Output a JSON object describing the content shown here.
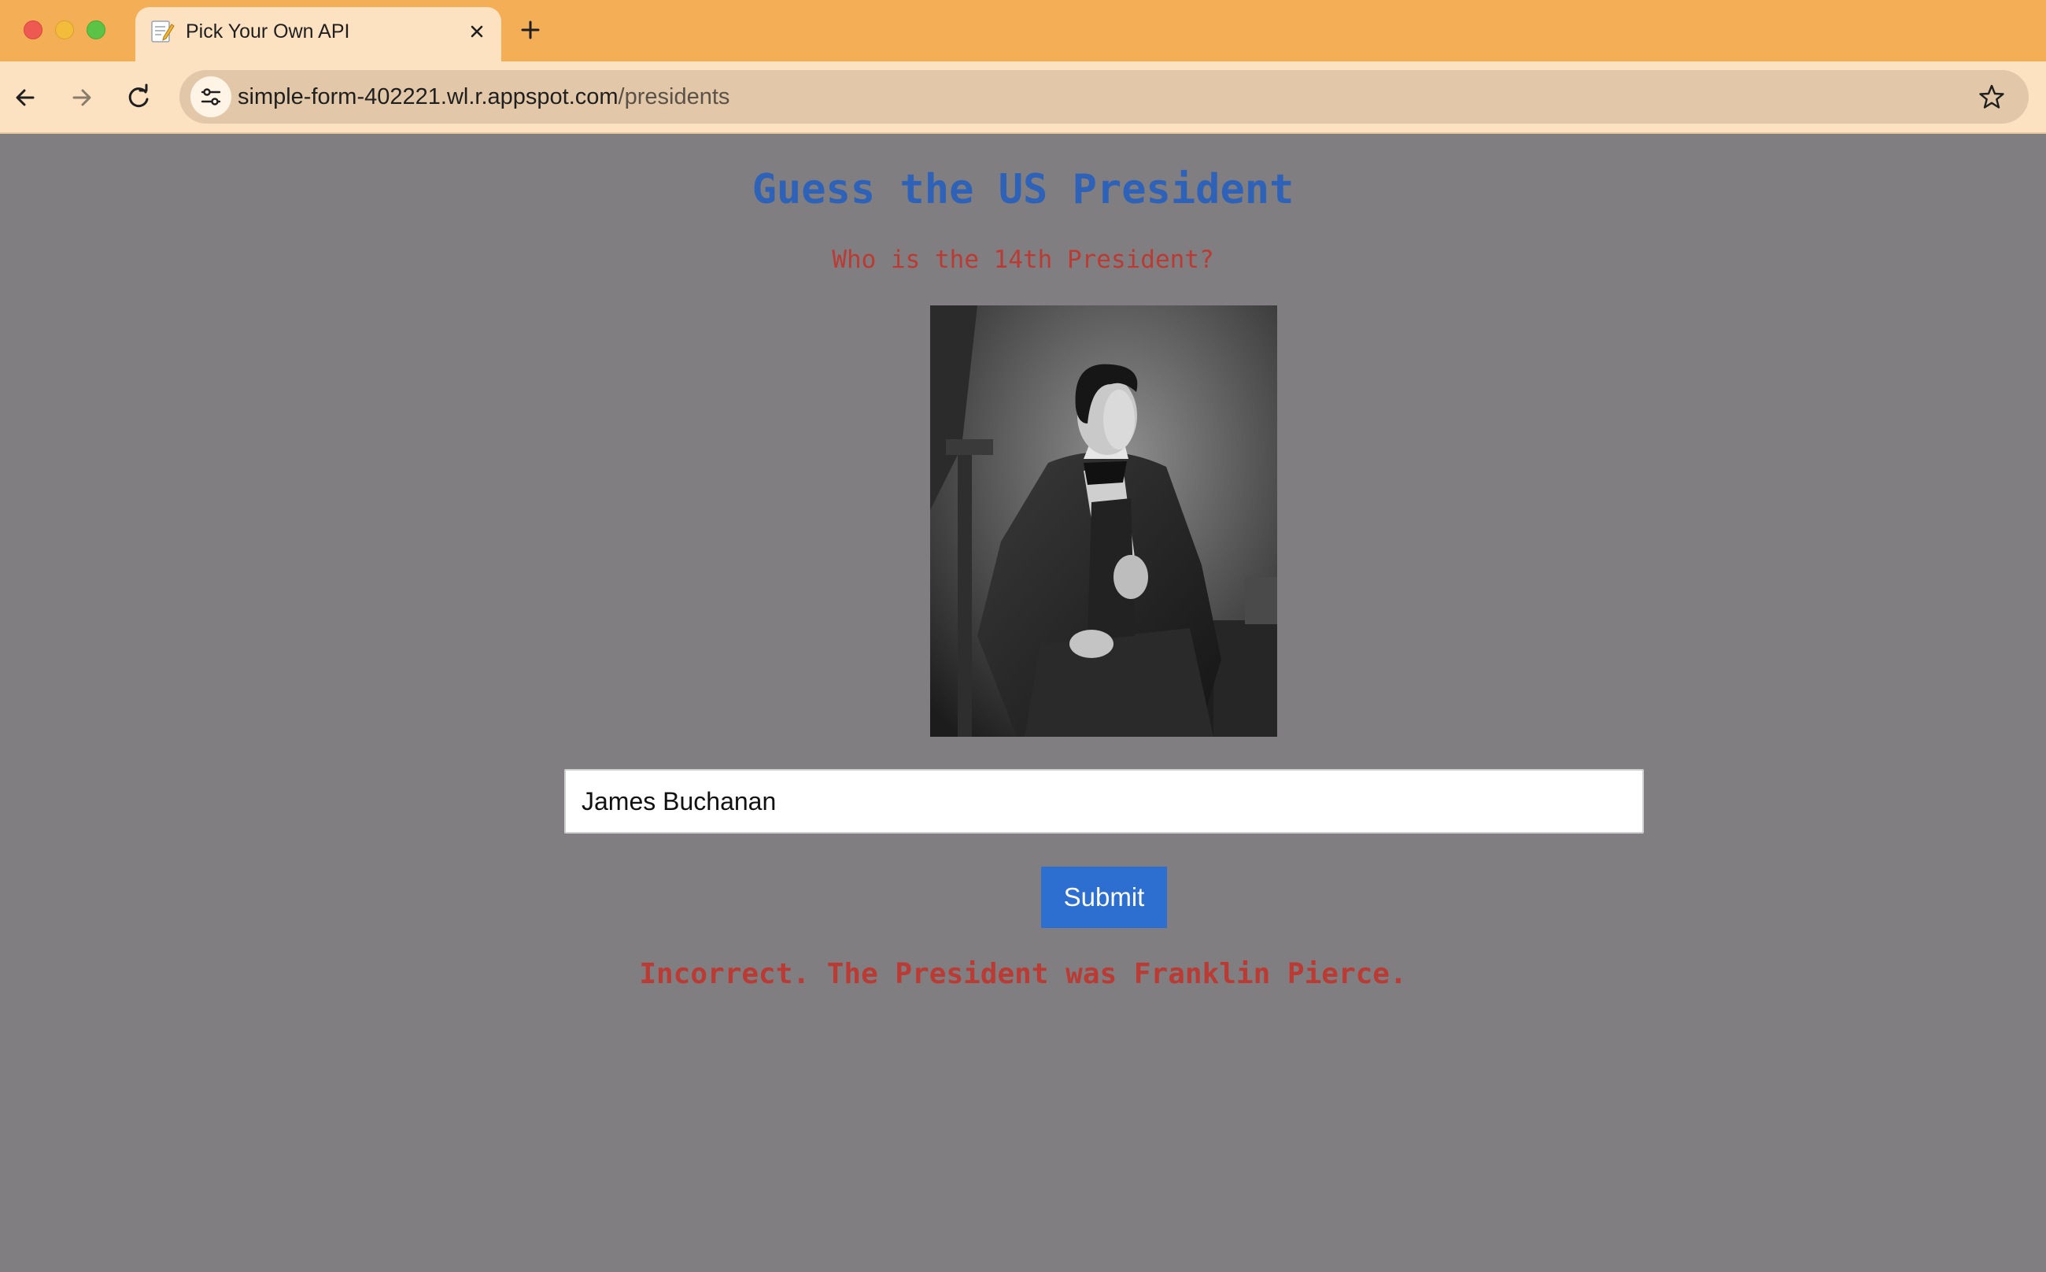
{
  "browser": {
    "tab_title": "Pick Your Own API",
    "tab_favicon": "memo-icon",
    "url_host": "simple-form-402221.wl.r.appspot.com",
    "url_path": "/presidents"
  },
  "page": {
    "heading": "Guess the US President",
    "question": "Who is the 14th President?",
    "portrait_icon": "president-portrait-image",
    "answer_value": "James Buchanan",
    "submit_label": "Submit",
    "result_text": "Incorrect. The President was Franklin Pierce."
  },
  "colors": {
    "tabbar": "#f4ae56",
    "toolbar": "#fde2c2",
    "page_background": "#807e80",
    "heading": "#2d62b8",
    "question": "#bb3a33",
    "button": "#2d6fd0",
    "result": "#bb3a33"
  }
}
